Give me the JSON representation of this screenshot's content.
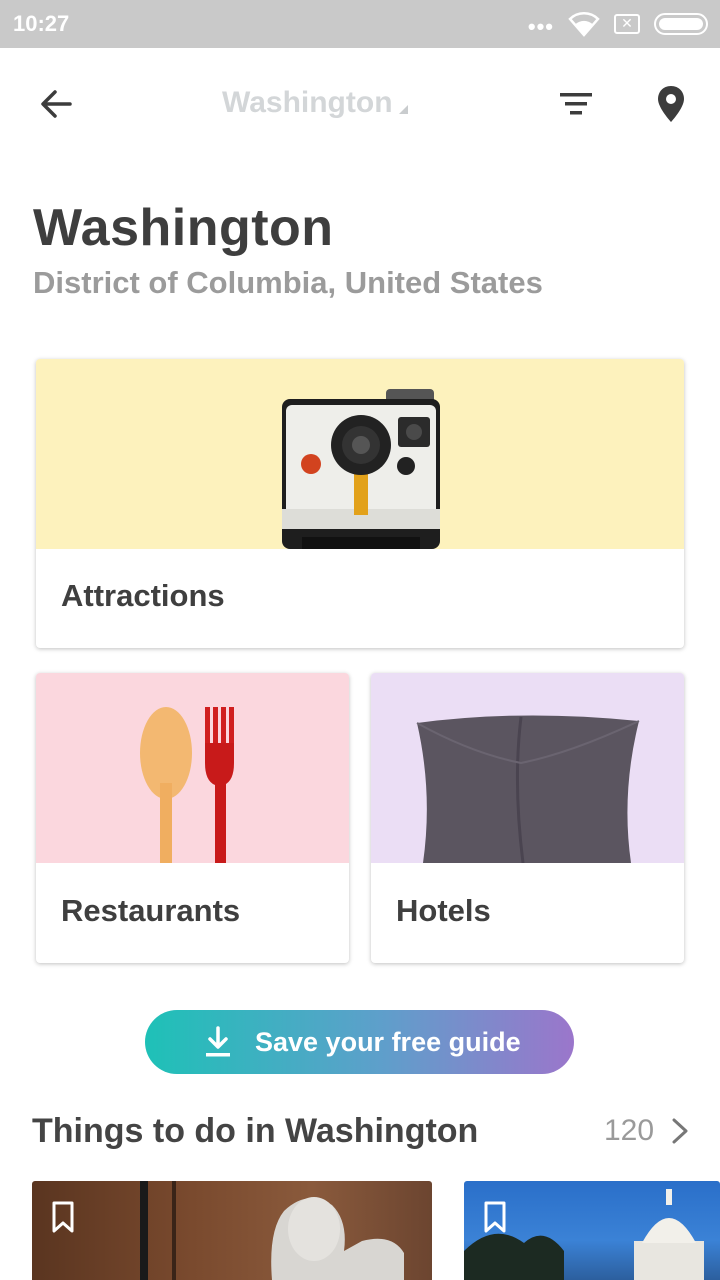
{
  "status_bar": {
    "time": "10:27",
    "dots": "•••",
    "sim_glyph": "✕",
    "icons": [
      "wifi-icon",
      "sim-icon",
      "battery-icon"
    ],
    "background": "#c9c9c9"
  },
  "app_bar": {
    "title": "Washington",
    "icons": [
      "back-arrow-icon",
      "filter-icon",
      "location-pin-icon"
    ]
  },
  "header": {
    "title": "Washington",
    "subtitle": "District of Columbia, United States"
  },
  "categories": [
    {
      "label": "Attractions",
      "image": "polaroid-camera",
      "color": "#fdf2bd"
    },
    {
      "label": "Restaurants",
      "image": "spoon-and-fork",
      "color": "#fbd7de"
    },
    {
      "label": "Hotels",
      "image": "pillow",
      "color": "#ebdef5"
    }
  ],
  "save_button": {
    "label": "Save your free guide",
    "icon": "download-icon",
    "gradient": [
      "#1ec1b7",
      "#9b76cb"
    ]
  },
  "things_to_do": {
    "title": "Things to do in Washington",
    "count": "120",
    "items": [
      {
        "image": "lincoln-memorial",
        "icon": "bookmark-icon"
      },
      {
        "image": "us-capitol",
        "icon": "bookmark-icon"
      }
    ]
  }
}
